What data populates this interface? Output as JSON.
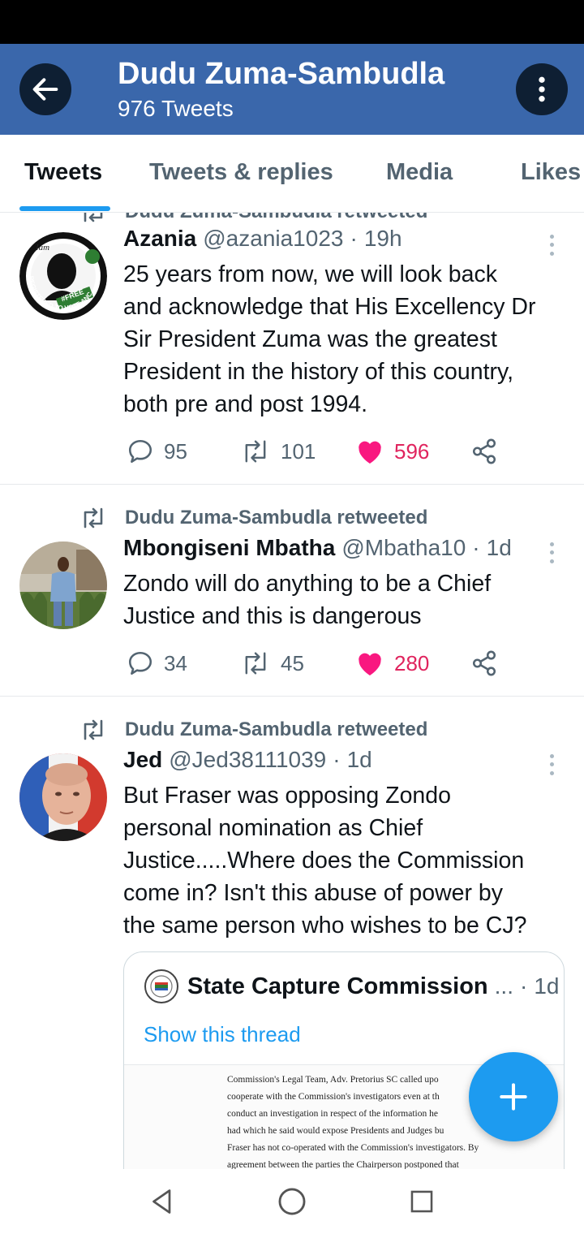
{
  "header": {
    "title": "Dudu Zuma-Sambudla",
    "subtitle": "976 Tweets",
    "back_icon": "arrow-left-icon",
    "menu_icon": "more-vertical-icon",
    "color": "#3a67ab"
  },
  "tabs": [
    {
      "label": "Tweets",
      "active": true
    },
    {
      "label": "Tweets & replies",
      "active": false
    },
    {
      "label": "Media",
      "active": false
    },
    {
      "label": "Likes",
      "active": false
    }
  ],
  "tweets": [
    {
      "name": "Azania",
      "handle": "@azania1023",
      "time": "19h",
      "retweeted_by": "Dudu Zuma-Sambudla retweeted",
      "text_lines": [
        "25 years from now, we will look back",
        "and acknowledge that His Excellency Dr",
        "Sir President Zuma was the greatest",
        "President in the history of this country,",
        "both pre and post 1994."
      ],
      "avatar_text": {
        "top": "Iam",
        "ring": "REGISTERED TO VOTE ANC",
        "badge": "#FREE"
      },
      "replies": "95",
      "retweets": "101",
      "likes": "596"
    },
    {
      "name": "Mbongiseni Mbatha",
      "handle": "@Mbatha10",
      "time": "1d",
      "retweeted_by": "Dudu Zuma-Sambudla retweeted",
      "text_lines": [
        "Zondo will do anything to be a Chief",
        "Justice and this is dangerous"
      ],
      "replies": "34",
      "retweets": "45",
      "likes": "280"
    },
    {
      "name": "Jed",
      "handle": "@Jed38111039",
      "time": "1d",
      "retweeted_by": "Dudu Zuma-Sambudla retweeted",
      "text_lines": [
        "But Fraser was opposing Zondo",
        "personal nomination as Chief",
        "Justice.....Where does the Commission",
        "come in? Isn't this abuse of power by",
        "the same person who wishes to be CJ?"
      ],
      "quote": {
        "name": "State Capture Commission",
        "ellipsis": "...",
        "time": "1d",
        "show_thread": "Show this thread",
        "doc_lines": [
          "Commission's Legal Team, Adv. Pretorius SC called upo",
          "cooperate with the Commission's investigators even at th",
          "conduct an investigation in respect of the information he",
          "had which he said would expose Presidents and Judges bu",
          "Fraser has not co-operated with the Commission's investigators. By",
          "agreement between the parties the Chairperson postponed that"
        ]
      }
    }
  ],
  "fab_icon": "plus-icon",
  "nav": [
    "back-triangle-icon",
    "home-circle-icon",
    "recents-square-icon"
  ],
  "colors": {
    "accent": "#1d9bf0",
    "like": "#e0245e",
    "muted": "#536471"
  }
}
